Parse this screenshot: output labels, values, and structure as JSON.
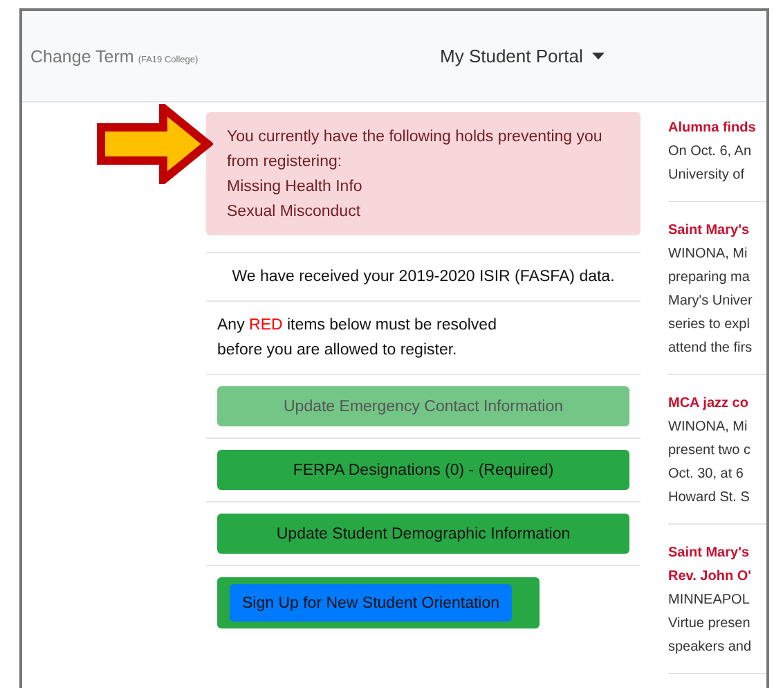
{
  "header": {
    "change_term": "Change Term",
    "term": "(FA19 College)",
    "portal_menu": "My Student Portal"
  },
  "alert": {
    "lines": [
      "You currently have the following holds preventing you from registering:",
      "Missing Health Info",
      "Sexual Misconduct"
    ]
  },
  "notices": [
    {
      "kind": "plain",
      "text": "We have received your 2019-2020 ISIR (FASFA) data."
    },
    {
      "kind": "segments",
      "segments": [
        {
          "text": "Any ",
          "red": false
        },
        {
          "text": "RED",
          "red": true
        },
        {
          "text": " items below must be resolved\nbefore you are allowed to register.",
          "red": false
        }
      ]
    }
  ],
  "actions": [
    {
      "kind": "plain",
      "label": "Update Emergency Contact Information",
      "disabled": true
    },
    {
      "kind": "plain",
      "label": "FERPA Designations (0) - (Required)",
      "disabled": false
    },
    {
      "kind": "plain",
      "label": "Update Student Demographic Information",
      "disabled": false
    },
    {
      "kind": "nested",
      "label": "Sign Up for New Student Orientation",
      "disabled": false
    }
  ],
  "news": [
    {
      "title": [
        "Alumna finds"
      ],
      "body": [
        "On Oct. 6, An",
        "University of"
      ]
    },
    {
      "title": [
        "Saint Mary's"
      ],
      "body": [
        "WINONA, Mi",
        "preparing ma",
        "Mary's Univer",
        "series to expl",
        "attend the firs"
      ]
    },
    {
      "title": [
        "MCA jazz co"
      ],
      "body": [
        "WINONA, Mi",
        "present two c",
        "Oct. 30, at 6",
        "Howard St. S"
      ]
    },
    {
      "title": [
        "Saint Mary's",
        "Rev. John O'"
      ],
      "body": [
        "MINNEAPOL",
        "Virtue presen",
        "speakers and"
      ]
    }
  ]
}
